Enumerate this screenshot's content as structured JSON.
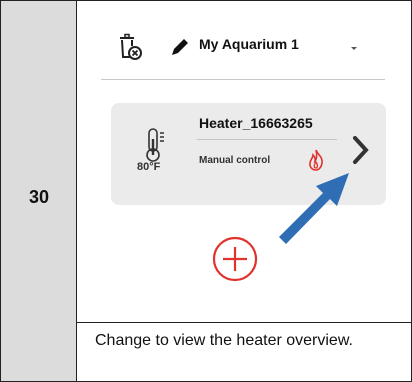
{
  "step": {
    "number": "30"
  },
  "app": {
    "aquarium_name": "My Aquarium 1",
    "header_icons": [
      "trash-icon",
      "pencil-icon",
      "dropdown-caret-icon"
    ]
  },
  "device_card": {
    "name": "Heater_16663265",
    "temperature": "80°F",
    "mode": "Manual control",
    "icons": [
      "thermometer-icon",
      "flame-icon",
      "chevron-right-icon"
    ]
  },
  "add_button": {
    "icon": "plus-circle-icon"
  },
  "caption": "Change to view the heater overview.",
  "colors": {
    "accent_red": "#e0332e",
    "arrow_blue": "#2f6db5",
    "card_bg": "#ebebeb",
    "step_col": "#dcdcdc"
  }
}
